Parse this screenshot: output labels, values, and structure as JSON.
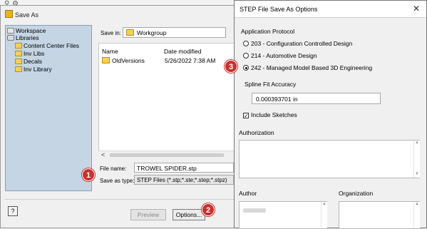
{
  "saveas": {
    "title": "Save As",
    "tree": [
      {
        "label": "Workspace",
        "icon": "workspace-icon"
      },
      {
        "label": "Libraries",
        "icon": "libraries-icon"
      },
      {
        "label": "Content Center Files",
        "icon": "folder-icon"
      },
      {
        "label": "Inv Libs",
        "icon": "folder-icon"
      },
      {
        "label": "Decals",
        "icon": "folder-icon"
      },
      {
        "label": "Inv Library",
        "icon": "folder-icon"
      }
    ],
    "save_in_label": "Save in:",
    "save_in_value": "Workgroup",
    "columns": {
      "name": "Name",
      "date": "Date modified"
    },
    "files": [
      {
        "name": "OldVersions",
        "date": "5/26/2022 7:38 AM"
      }
    ],
    "file_name_label": "File name:",
    "file_name_value": "TROWEL SPIDER.stp",
    "save_as_type_label": "Save as type:",
    "save_as_type_value": "STEP Files (*.stp;*.ste;*.step;*.stpz)",
    "help_label": "?",
    "preview_label": "Preview",
    "options_label": "Options..."
  },
  "callouts": [
    "1",
    "2",
    "3"
  ],
  "step": {
    "title": "STEP File Save As Options",
    "close_glyph": "✕",
    "application_protocol_label": "Application Protocol",
    "protocols": [
      {
        "label": "203 - Configuration Controlled Design",
        "selected": false
      },
      {
        "label": "214 - Automotive Design",
        "selected": false
      },
      {
        "label": "242 - Managed Model Based 3D Engineering",
        "selected": true
      }
    ],
    "spline_label": "Spline Fit Accuracy",
    "spline_value": "0.000393701 in",
    "include_sketches_label": "Include Sketches",
    "include_sketches_checked": true,
    "authorization_label": "Authorization",
    "author_label": "Author",
    "organization_label": "Organization"
  },
  "colors": {
    "callout": "#c8312e",
    "library_panel": "#c5d5e4"
  }
}
